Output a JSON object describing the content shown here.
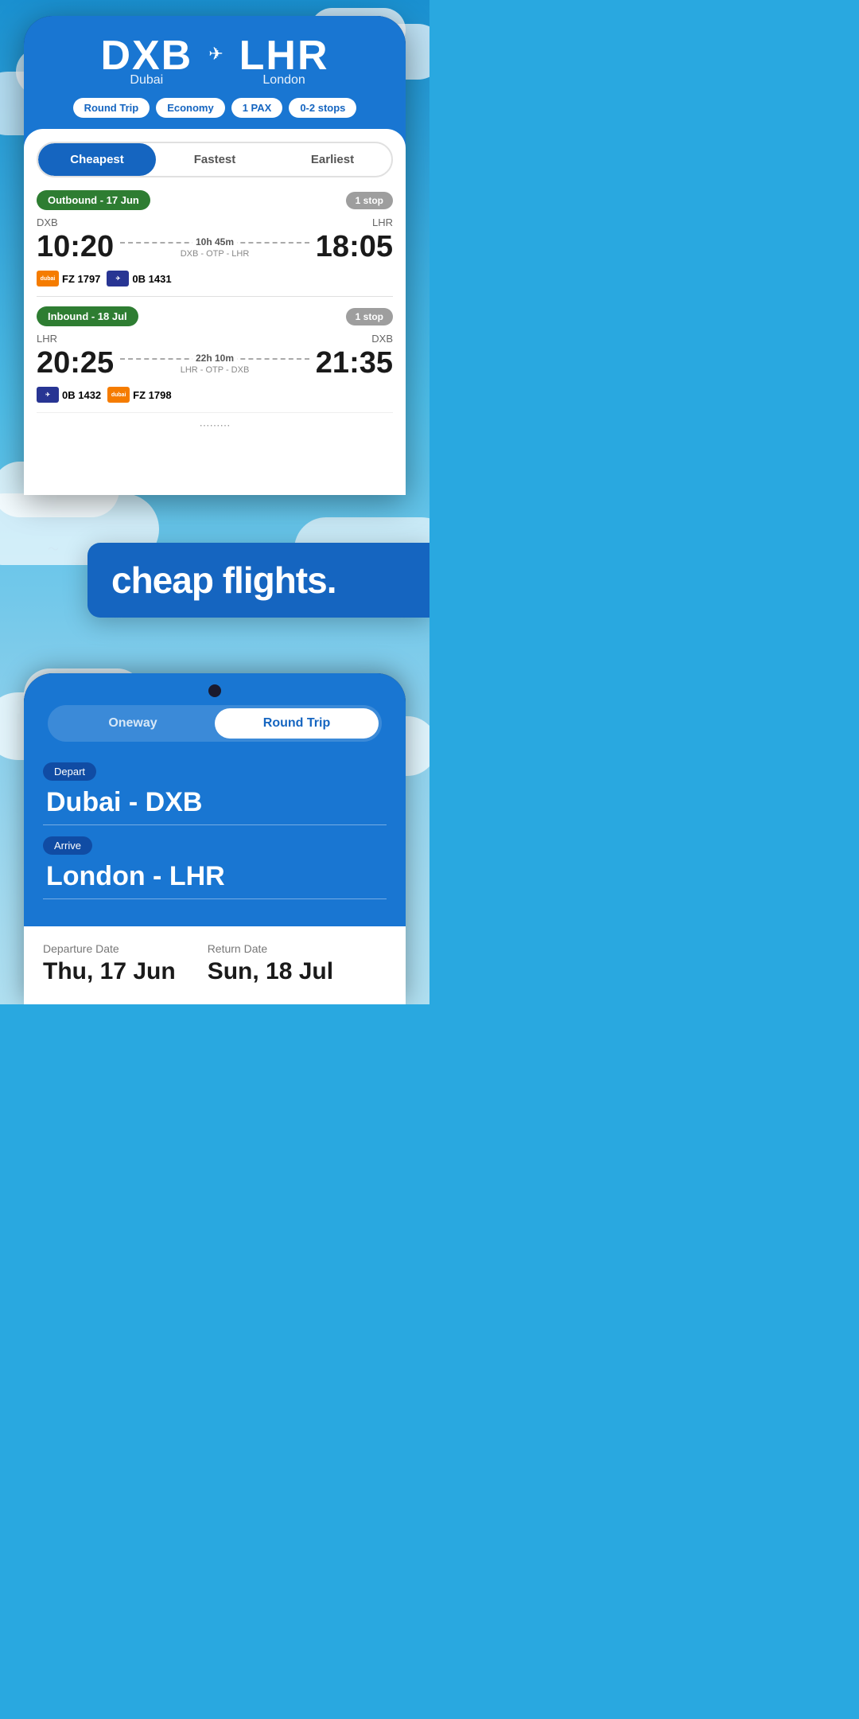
{
  "header": {
    "origin_code": "DXB",
    "origin_city": "Dubai",
    "destination_code": "LHR",
    "destination_city": "London",
    "plane_symbol": "→✈",
    "tags": {
      "trip_type": "Round Trip",
      "cabin": "Economy",
      "pax": "1 PAX",
      "stops": "0-2 stops"
    }
  },
  "tabs": {
    "cheapest": "Cheapest",
    "fastest": "Fastest",
    "earliest": "Earliest"
  },
  "outbound": {
    "label": "Outbound - 17 Jun",
    "stop_badge": "1 stop",
    "origin": "DXB",
    "destination": "LHR",
    "depart_time": "10:20",
    "arrive_time": "18:05",
    "duration": "10h 45m",
    "route": "DXB - OTP - LHR",
    "airlines": [
      {
        "logo": "FZ",
        "color": "orange",
        "flight": "FZ 1797"
      },
      {
        "logo": "0B",
        "color": "blue",
        "flight": "0B 1431"
      }
    ]
  },
  "inbound": {
    "label": "Inbound - 18 Jul",
    "stop_badge": "1 stop",
    "origin": "LHR",
    "destination": "DXB",
    "depart_time": "20:25",
    "arrive_time": "21:35",
    "duration": "22h 10m",
    "route": "LHR - OTP - DXB",
    "airlines": [
      {
        "logo": "0B",
        "color": "blue",
        "flight": "0B 1432"
      },
      {
        "logo": "FZ",
        "color": "orange",
        "flight": "FZ 1798"
      }
    ]
  },
  "promo": {
    "text": "cheap flights."
  },
  "search_form": {
    "toggle": {
      "oneway": "Oneway",
      "round_trip": "Round Trip"
    },
    "depart_label": "Depart",
    "depart_value": "Dubai - DXB",
    "arrive_label": "Arrive",
    "arrive_value": "London - LHR",
    "departure_date_label": "Departure Date",
    "departure_date_value": "Thu, 17 Jun",
    "return_date_label": "Return Date",
    "return_date_value": "Sun, 18 Jul"
  }
}
